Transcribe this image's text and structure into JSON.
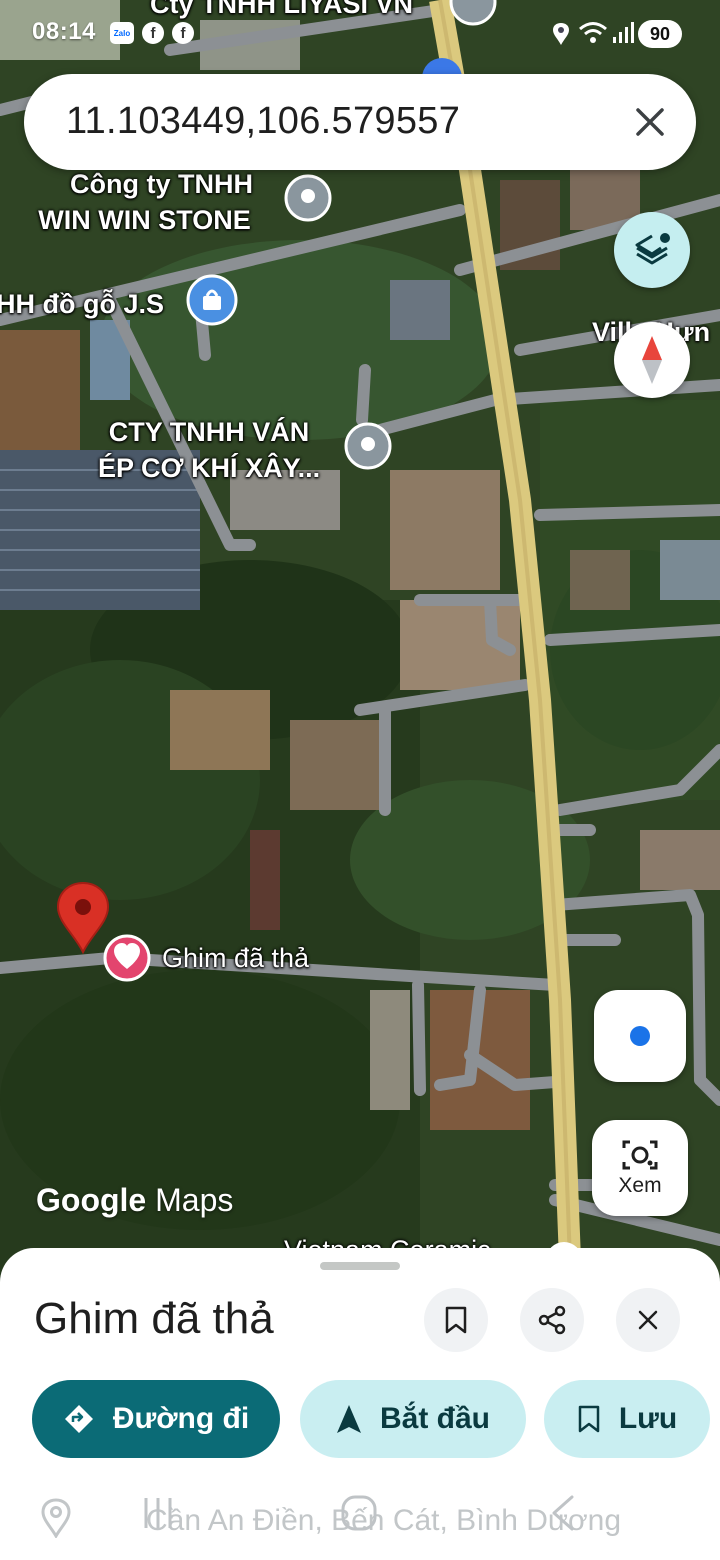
{
  "status_bar": {
    "time": "08:14",
    "notification_icons": [
      "zalo-icon",
      "facebook-icon",
      "facebook-icon"
    ],
    "zalo_text": "Zalo",
    "battery": "90"
  },
  "search": {
    "query": "11.103449,106.579557"
  },
  "map": {
    "labels": {
      "liyasi": "Cty TNHH LIYASI VN",
      "winwin_line1": "Công ty TNHH",
      "winwin_line2": "WIN WIN STONE",
      "dogo": "HH đồ gỗ J.S",
      "villa": "Villa Hưn",
      "vanep_line1": "CTY TNHH VÁN",
      "vanep_line2": "ÉP CƠ KHÍ XÂY...",
      "pin": "Ghim đã thả",
      "vietnam": "Vietnam Ceramic"
    },
    "logo_google": "Google",
    "logo_maps": "Maps",
    "colors": {
      "main_road": "#c8b36c",
      "side_road": "#8c9094",
      "pin": "#d93025",
      "accent": "#0b6b76"
    }
  },
  "buttons": {
    "xem_label": "Xem"
  },
  "sheet": {
    "title": "Ghim đã thả",
    "actions": {
      "directions": "Đường đi",
      "start": "Bắt đầu",
      "save": "Lưu"
    },
    "address": "Cần An Điền, Bến Cát, Bình Dương"
  }
}
